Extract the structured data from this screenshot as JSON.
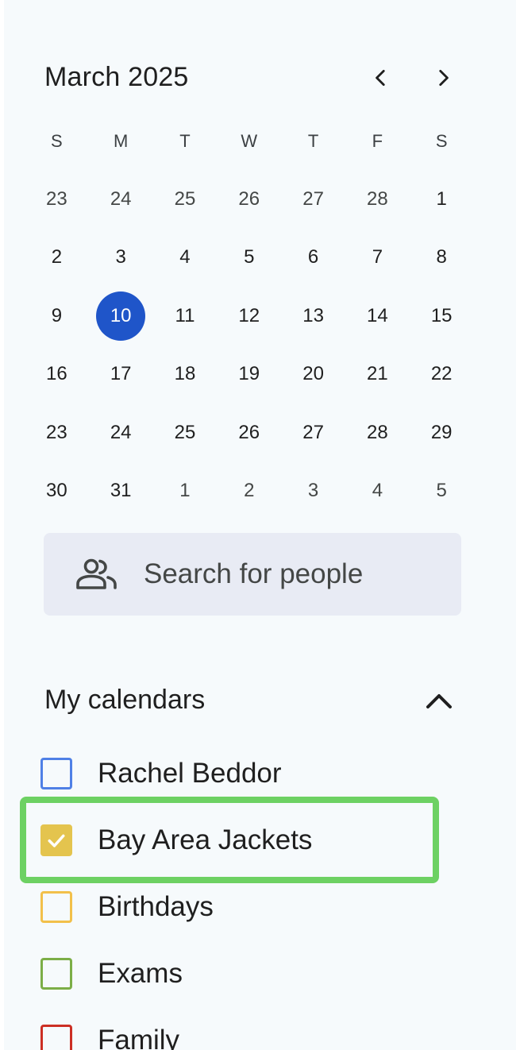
{
  "mini_calendar": {
    "month_title": "March 2025",
    "prev_icon": "chevron-left-icon",
    "next_icon": "chevron-right-icon",
    "weekdays": [
      "S",
      "M",
      "T",
      "W",
      "T",
      "F",
      "S"
    ],
    "weeks": [
      [
        "23",
        "24",
        "25",
        "26",
        "27",
        "28",
        "1"
      ],
      [
        "2",
        "3",
        "4",
        "5",
        "6",
        "7",
        "8"
      ],
      [
        "9",
        "10",
        "11",
        "12",
        "13",
        "14",
        "15"
      ],
      [
        "16",
        "17",
        "18",
        "19",
        "20",
        "21",
        "22"
      ],
      [
        "23",
        "24",
        "25",
        "26",
        "27",
        "28",
        "29"
      ],
      [
        "30",
        "31",
        "1",
        "2",
        "3",
        "4",
        "5"
      ]
    ],
    "outside_month": [
      [
        true,
        true,
        true,
        true,
        true,
        true,
        false
      ],
      [
        false,
        false,
        false,
        false,
        false,
        false,
        false
      ],
      [
        false,
        false,
        false,
        false,
        false,
        false,
        false
      ],
      [
        false,
        false,
        false,
        false,
        false,
        false,
        false
      ],
      [
        false,
        false,
        false,
        false,
        false,
        false,
        false
      ],
      [
        false,
        false,
        true,
        true,
        true,
        true,
        true
      ]
    ],
    "today": "10",
    "today_color": "#1f55c9"
  },
  "search": {
    "placeholder": "Search for people",
    "icon": "people-icon"
  },
  "my_calendars": {
    "title": "My calendars",
    "collapse_icon": "chevron-up-icon",
    "items": [
      {
        "label": "Rachel Beddor",
        "color": "#4f80e6",
        "checked": false
      },
      {
        "label": "Bay Area Jackets",
        "color": "#e4c44e",
        "checked": true
      },
      {
        "label": "Birthdays",
        "color": "#f2c04a",
        "checked": false
      },
      {
        "label": "Exams",
        "color": "#7cae47",
        "checked": false
      },
      {
        "label": "Family",
        "color": "#cc2f24",
        "checked": false
      }
    ]
  },
  "highlight_color": "#6dd163"
}
